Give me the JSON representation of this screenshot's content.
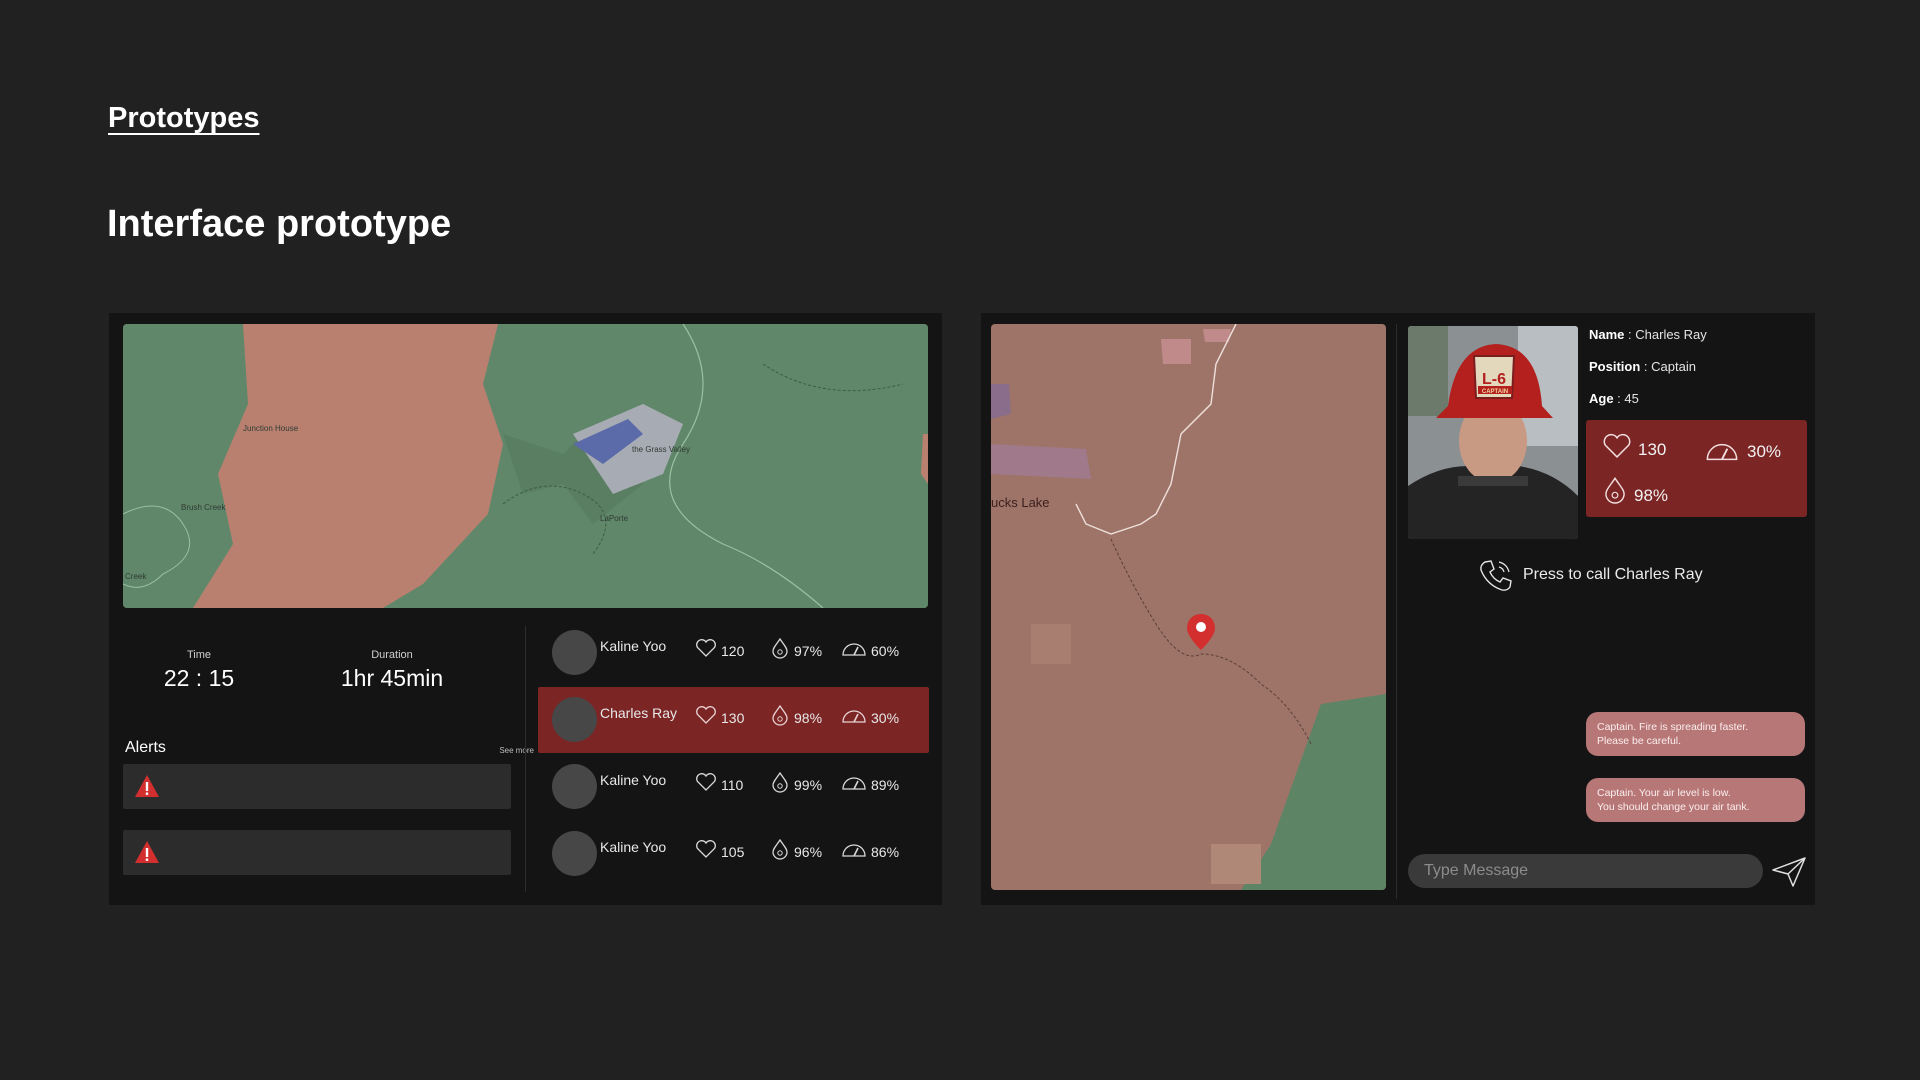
{
  "header": {
    "section_link": "Prototypes",
    "title": "Interface prototype"
  },
  "left_panel": {
    "map": {
      "labels": [
        "Junction House",
        "the Grass Valley",
        "LaPorte",
        "Brush Creek",
        "Creek"
      ]
    },
    "time": {
      "label": "Time",
      "value": "22 : 15"
    },
    "duration": {
      "label": "Duration",
      "value": "1hr 45min"
    },
    "alerts": {
      "title": "Alerts",
      "see_more": "See more",
      "count": 2
    },
    "crew": [
      {
        "name": "Kaline Yoo",
        "heart": "120",
        "oxygen": "97%",
        "air": "60%",
        "active": false
      },
      {
        "name": "Charles Ray",
        "heart": "130",
        "oxygen": "98%",
        "air": "30%",
        "active": true
      },
      {
        "name": "Kaline Yoo",
        "heart": "110",
        "oxygen": "99%",
        "air": "89%",
        "active": false
      },
      {
        "name": "Kaline Yoo",
        "heart": "105",
        "oxygen": "96%",
        "air": "86%",
        "active": false
      }
    ]
  },
  "right_panel": {
    "map": {
      "label": "ucks Lake"
    },
    "profile": {
      "name_label": "Name",
      "name": "Charles Ray",
      "position_label": "Position",
      "position": "Captain",
      "age_label": "Age",
      "age": "45",
      "helmet_text": "L-6",
      "helmet_rank": "CAPTAIN"
    },
    "vitals": {
      "heart": "130",
      "air": "30%",
      "oxygen": "98%"
    },
    "call_label": "Press to call Charles Ray",
    "messages": [
      {
        "line1": "Captain. Fire is spreading faster.",
        "line2": "Please be careful."
      },
      {
        "line1": "Captain. Your air level is low.",
        "line2": "You should change your air tank."
      }
    ],
    "input_placeholder": "Type Message"
  },
  "colors": {
    "background": "#212121",
    "panel": "#141414",
    "alert_red": "#7b2525",
    "bubble": "#b87777",
    "map_green": "#5e8466",
    "map_fire": "#b98070"
  }
}
